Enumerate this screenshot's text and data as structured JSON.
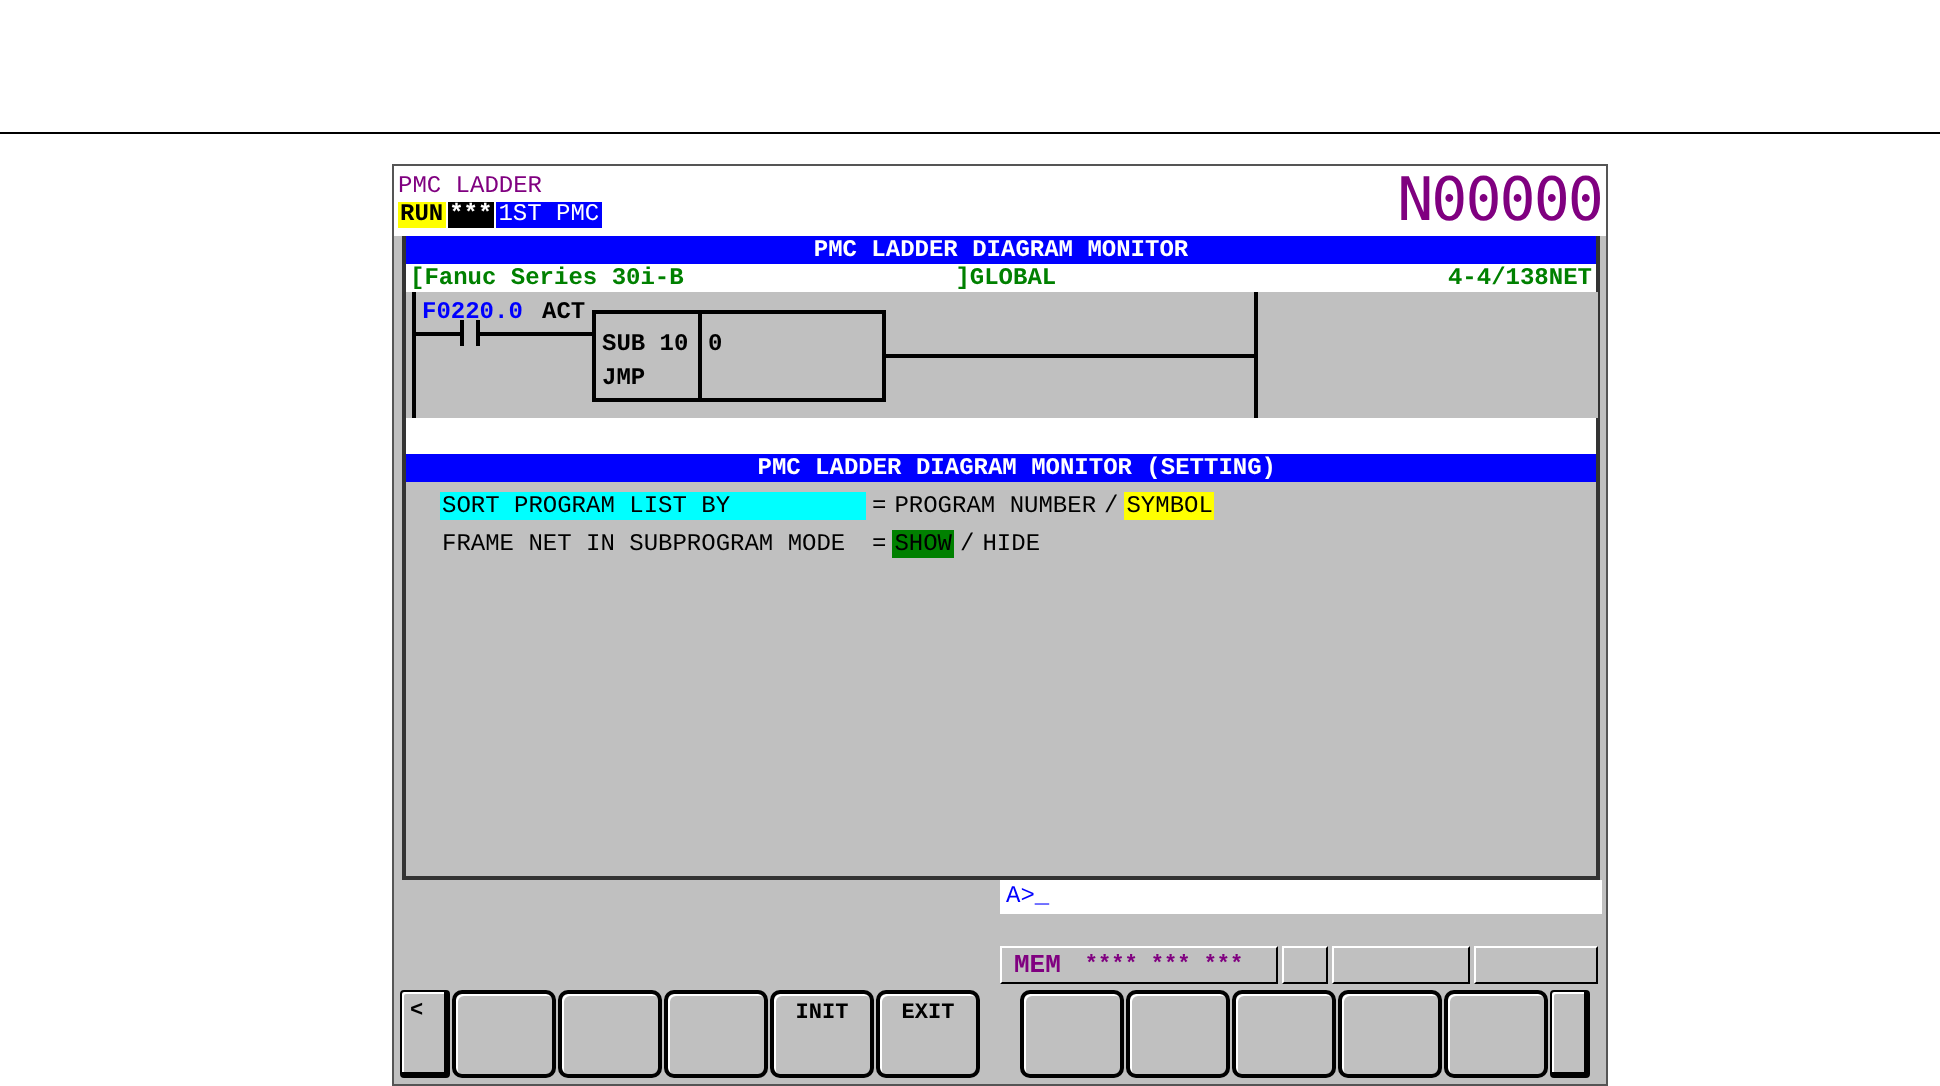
{
  "header": {
    "title": "PMC LADDER",
    "status": [
      {
        "kind": "run",
        "label": "RUN"
      },
      {
        "kind": "alarm",
        "label": "***"
      },
      {
        "kind": "path",
        "label": "1ST PMC"
      }
    ],
    "program_number": "N00000"
  },
  "monitor": {
    "title": "PMC LADDER DIAGRAM MONITOR",
    "info": {
      "left": "[Fanuc Series 30i-B",
      "middle": "]GLOBAL",
      "right": "4-4/138NET"
    },
    "ladder": {
      "contact_address": "F0220.0",
      "contact_symbol": "ACT",
      "function": "SUB 10",
      "function_name": "JMP",
      "parameter": "0"
    }
  },
  "settings": {
    "title": "PMC LADDER DIAGRAM MONITOR (SETTING)",
    "rows": [
      {
        "label": "SORT PROGRAM LIST BY",
        "focused": true,
        "equals": "=",
        "separator": "/",
        "options": [
          {
            "label": "PROGRAM NUMBER",
            "selected": false
          },
          {
            "label": "SYMBOL",
            "selected": true
          }
        ]
      },
      {
        "label": "FRAME NET IN SUBPROGRAM MODE",
        "focused": false,
        "equals": "=",
        "separator": "/",
        "options": [
          {
            "label": "SHOW",
            "selected": true
          },
          {
            "label": "HIDE",
            "selected": false
          }
        ]
      }
    ]
  },
  "input_line": "A>_",
  "status_bar": {
    "mode": "MEM",
    "indicators": "**** *** ***"
  },
  "soft_keys": {
    "left": [
      {
        "kind": "prev",
        "label": "<"
      },
      {
        "kind": "blank"
      },
      {
        "kind": "blank"
      },
      {
        "kind": "blank"
      },
      {
        "kind": "text",
        "label": "INIT"
      },
      {
        "kind": "text",
        "label": "EXIT"
      }
    ],
    "right": [
      {
        "kind": "blank"
      },
      {
        "kind": "blank"
      },
      {
        "kind": "blank"
      },
      {
        "kind": "blank"
      },
      {
        "kind": "blank"
      },
      {
        "kind": "next"
      }
    ]
  }
}
